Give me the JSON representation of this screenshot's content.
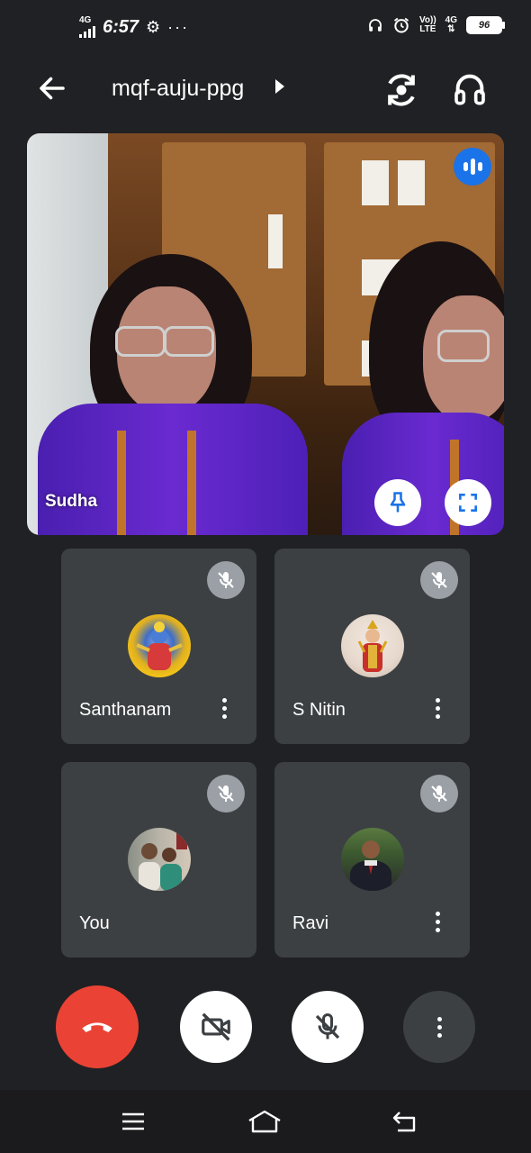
{
  "status_bar": {
    "network": "4G",
    "time": "6:57",
    "icons": [
      "signal-icon",
      "gear-icon",
      "more-notifications-icon",
      "headphones-icon",
      "alarm-icon",
      "volte-icon",
      "4g-lte-icon",
      "battery-icon"
    ],
    "volte_top": "Vo))",
    "volte_bottom": "LTE",
    "data_net": "4G",
    "battery": "96"
  },
  "header": {
    "meeting_code": "mqf-auju-ppg",
    "icons": [
      "back-arrow-icon",
      "chevron-right-icon",
      "camera-switch-icon",
      "headphones-icon"
    ]
  },
  "main_video": {
    "participant": "Sudha",
    "speaking": true,
    "icons": [
      "speaking-bars-icon",
      "pin-icon",
      "fullscreen-icon"
    ]
  },
  "participants": [
    {
      "name": "Santhanam",
      "muted": true,
      "avatar": "deity-avatar",
      "has_menu": true
    },
    {
      "name": "S Nitin",
      "muted": true,
      "avatar": "deity-avatar",
      "has_menu": true
    },
    {
      "name": "You",
      "muted": true,
      "avatar": "couple-photo-avatar",
      "has_menu": false
    },
    {
      "name": "Ravi",
      "muted": true,
      "avatar": "portrait-avatar",
      "has_menu": true
    }
  ],
  "controls": {
    "icons": [
      "end-call-icon",
      "camera-off-icon",
      "mic-off-icon",
      "more-vert-icon"
    ],
    "colors": {
      "end_call": "#ea4335",
      "tile": "#3c4043",
      "background": "#202124",
      "speaking": "#1a73e8"
    }
  },
  "nav_bar": {
    "icons": [
      "menu-icon",
      "home-icon",
      "back-icon"
    ]
  }
}
